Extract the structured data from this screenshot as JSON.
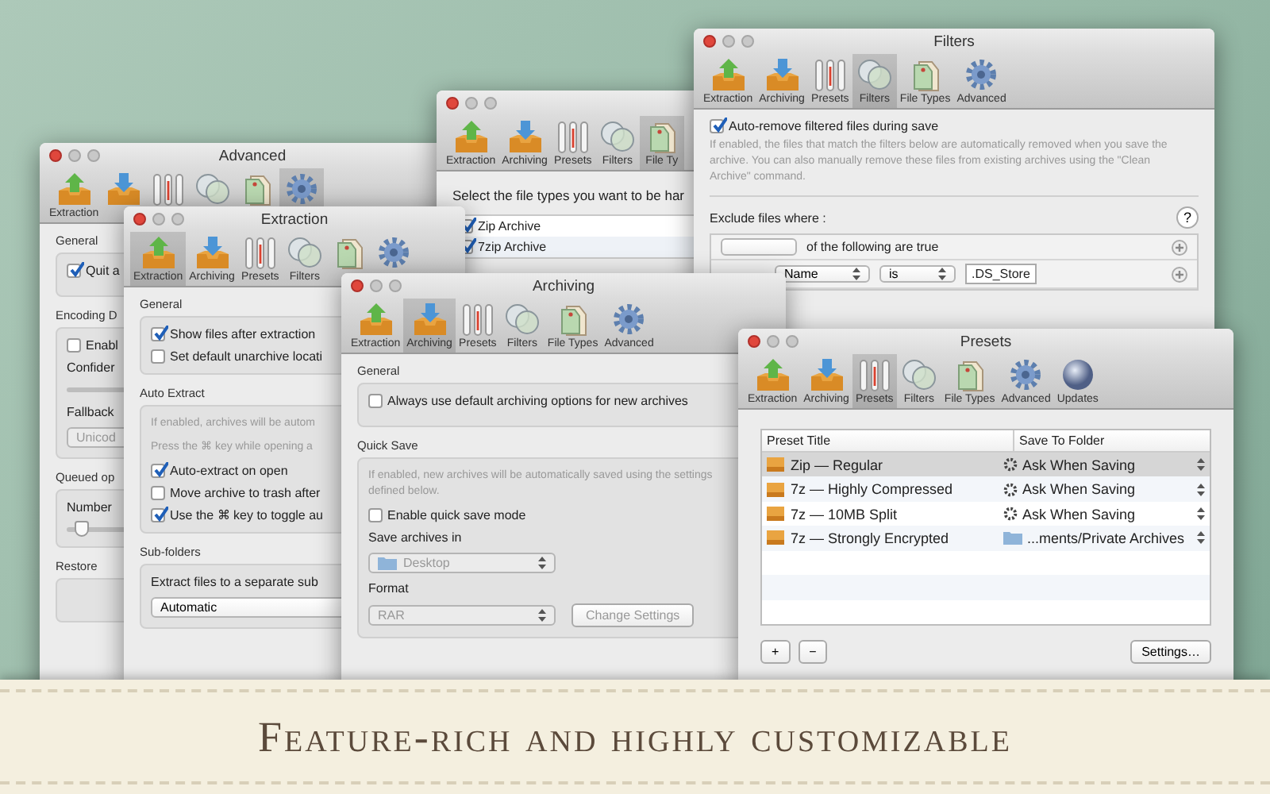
{
  "windows": [
    {
      "kind": "advanced",
      "title": "Advanced",
      "toolbar": [
        {
          "label": "Extraction",
          "selected": false
        },
        {
          "selected": false
        },
        {
          "selected": false
        },
        {
          "selected": false
        },
        {
          "selected": false
        },
        {
          "selected": true
        }
      ],
      "sections": [
        {
          "title": "General",
          "items": [
            {
              "kind": "checkbox",
              "label": "Quit a",
              "checked": true
            }
          ]
        },
        {
          "title": "Encoding D",
          "items": [
            {
              "kind": "checkbox",
              "label": "Enabl",
              "checked": false
            },
            {
              "kind": "label",
              "text": "Confider"
            },
            {
              "kind": "track"
            },
            {
              "kind": "label",
              "text": "Fallback"
            },
            {
              "kind": "popup",
              "value": "Unicod",
              "disabled": true
            }
          ]
        },
        {
          "title": "Queued op",
          "items": [
            {
              "kind": "label",
              "text": "Number"
            },
            {
              "kind": "slider",
              "level": 0.05
            }
          ]
        },
        {
          "title": "Restore"
        }
      ]
    },
    {
      "kind": "filetypes",
      "toolbar": [
        {
          "label": "Extraction",
          "selected": false
        },
        {
          "label": "Archiving",
          "selected": false
        },
        {
          "label": "Presets",
          "selected": false
        },
        {
          "label": "Filters",
          "selected": false
        },
        {
          "label": "File Ty",
          "selected": true
        }
      ],
      "prompt": "Select the file types you want to be har",
      "file_types": [
        {
          "label": "Zip Archive",
          "checked": true
        },
        {
          "label": "7zip Archive",
          "checked": true
        }
      ]
    },
    {
      "kind": "filters",
      "title": "Filters",
      "toolbar": [
        {
          "label": "Extraction",
          "selected": false
        },
        {
          "label": "Archiving",
          "selected": false
        },
        {
          "label": "Presets",
          "selected": false
        },
        {
          "label": "Filters",
          "selected": true
        },
        {
          "label": "File Types",
          "selected": false
        },
        {
          "label": "Advanced",
          "selected": false
        }
      ],
      "auto_remove": {
        "label": "Auto-remove filtered files during save",
        "checked": true
      },
      "note": "If enabled, the files that match the filters below are automatically removed when you save the archive. You can also manually remove these files from existing archives using the \"Clean Archive\" command.",
      "exclude_label": "Exclude files where :",
      "help": "?",
      "rules": [
        {
          "kind": "match",
          "text": "of the following are true"
        },
        {
          "kind": "criterion",
          "field": "Name",
          "operator": "is",
          "value": ".DS_Store"
        }
      ]
    },
    {
      "kind": "extraction",
      "title": "Extraction",
      "toolbar": [
        {
          "label": "Extraction",
          "selected": true
        },
        {
          "label": "Archiving",
          "selected": false
        },
        {
          "label": "Presets",
          "selected": false
        },
        {
          "label": "Filters",
          "selected": false
        },
        {
          "selected": false
        },
        {
          "selected": false
        }
      ],
      "sections": [
        {
          "title": "General",
          "items": [
            {
              "kind": "checkbox",
              "label": "Show files after extraction",
              "checked": true
            },
            {
              "kind": "checkbox",
              "label": "Set default unarchive locati",
              "checked": false
            }
          ]
        },
        {
          "title": "Auto Extract",
          "items": [
            {
              "kind": "note",
              "text": "If enabled, archives will be autom"
            },
            {
              "kind": "note",
              "text": "Press the ⌘ key while opening a"
            },
            {
              "kind": "checkbox",
              "label": "Auto-extract on open",
              "checked": true
            },
            {
              "kind": "checkbox",
              "label": "Move archive to trash after",
              "checked": false
            },
            {
              "kind": "checkbox",
              "label": "Use the ⌘ key to toggle au",
              "checked": true
            }
          ]
        },
        {
          "title": "Sub-folders",
          "items": [
            {
              "kind": "label",
              "text": "Extract files to a separate sub"
            },
            {
              "kind": "popup",
              "value": "Automatic",
              "disabled": false
            }
          ]
        }
      ]
    },
    {
      "kind": "archiving",
      "title": "Archiving",
      "toolbar": [
        {
          "label": "Extraction",
          "selected": false
        },
        {
          "label": "Archiving",
          "selected": true
        },
        {
          "label": "Presets",
          "selected": false
        },
        {
          "label": "Filters",
          "selected": false
        },
        {
          "label": "File Types",
          "selected": false
        },
        {
          "label": "Advanced",
          "selected": false
        }
      ],
      "sections": [
        {
          "title": "General",
          "items": [
            {
              "kind": "checkbox",
              "label": "Always use default archiving options for new archives",
              "checked": false
            }
          ]
        },
        {
          "title": "Quick Save",
          "items": [
            {
              "kind": "note",
              "text": "If enabled, new archives will be automatically saved using the settings defined below."
            },
            {
              "kind": "checkbox",
              "label": "Enable quick save mode",
              "checked": false
            },
            {
              "kind": "label",
              "text": "Save archives in"
            },
            {
              "kind": "folder-popup",
              "value": "Desktop",
              "disabled": true
            },
            {
              "kind": "label",
              "text": "Format"
            },
            {
              "kind": "popup-button",
              "value": "RAR",
              "button": "Change Settings",
              "disabled": true
            }
          ]
        }
      ]
    },
    {
      "kind": "presets",
      "title": "Presets",
      "toolbar": [
        {
          "label": "Extraction",
          "selected": false
        },
        {
          "label": "Archiving",
          "selected": false
        },
        {
          "label": "Presets",
          "selected": true
        },
        {
          "label": "Filters",
          "selected": false
        },
        {
          "label": "File Types",
          "selected": false
        },
        {
          "label": "Advanced",
          "selected": false
        },
        {
          "label": "Updates",
          "selected": false
        }
      ],
      "columns": [
        "Preset Title",
        "Save To Folder"
      ],
      "rows": [
        {
          "title": "Zip — Regular",
          "folder": "Ask When Saving",
          "kind": "ask",
          "selected": true
        },
        {
          "title": "7z — Highly Compressed",
          "folder": "Ask When Saving",
          "kind": "ask",
          "selected": false
        },
        {
          "title": "7z — 10MB Split",
          "folder": "Ask When Saving",
          "kind": "ask",
          "selected": false
        },
        {
          "title": "7z — Strongly Encrypted",
          "folder": "...ments/Private Archives",
          "kind": "folder",
          "selected": false
        }
      ],
      "buttons": [
        "+",
        "−"
      ],
      "settings_button": "Settings…"
    }
  ],
  "banner": {
    "text": "Feature-rich and highly customizable"
  }
}
